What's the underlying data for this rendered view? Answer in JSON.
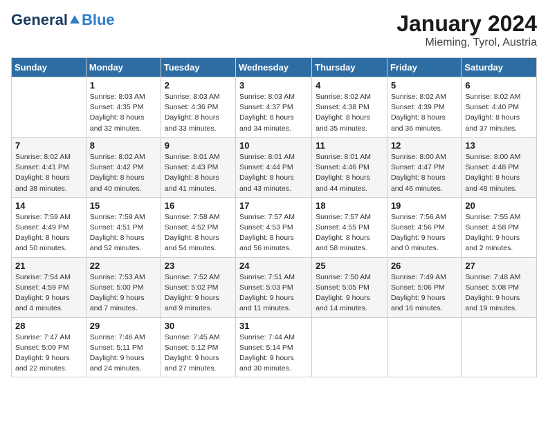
{
  "logo": {
    "general": "General",
    "blue": "Blue"
  },
  "title": "January 2024",
  "subtitle": "Mieming, Tyrol, Austria",
  "days_of_week": [
    "Sunday",
    "Monday",
    "Tuesday",
    "Wednesday",
    "Thursday",
    "Friday",
    "Saturday"
  ],
  "weeks": [
    [
      {
        "day": "",
        "detail": ""
      },
      {
        "day": "1",
        "detail": "Sunrise: 8:03 AM\nSunset: 4:35 PM\nDaylight: 8 hours\nand 32 minutes."
      },
      {
        "day": "2",
        "detail": "Sunrise: 8:03 AM\nSunset: 4:36 PM\nDaylight: 8 hours\nand 33 minutes."
      },
      {
        "day": "3",
        "detail": "Sunrise: 8:03 AM\nSunset: 4:37 PM\nDaylight: 8 hours\nand 34 minutes."
      },
      {
        "day": "4",
        "detail": "Sunrise: 8:02 AM\nSunset: 4:38 PM\nDaylight: 8 hours\nand 35 minutes."
      },
      {
        "day": "5",
        "detail": "Sunrise: 8:02 AM\nSunset: 4:39 PM\nDaylight: 8 hours\nand 36 minutes."
      },
      {
        "day": "6",
        "detail": "Sunrise: 8:02 AM\nSunset: 4:40 PM\nDaylight: 8 hours\nand 37 minutes."
      }
    ],
    [
      {
        "day": "7",
        "detail": "Sunrise: 8:02 AM\nSunset: 4:41 PM\nDaylight: 8 hours\nand 38 minutes."
      },
      {
        "day": "8",
        "detail": "Sunrise: 8:02 AM\nSunset: 4:42 PM\nDaylight: 8 hours\nand 40 minutes."
      },
      {
        "day": "9",
        "detail": "Sunrise: 8:01 AM\nSunset: 4:43 PM\nDaylight: 8 hours\nand 41 minutes."
      },
      {
        "day": "10",
        "detail": "Sunrise: 8:01 AM\nSunset: 4:44 PM\nDaylight: 8 hours\nand 43 minutes."
      },
      {
        "day": "11",
        "detail": "Sunrise: 8:01 AM\nSunset: 4:46 PM\nDaylight: 8 hours\nand 44 minutes."
      },
      {
        "day": "12",
        "detail": "Sunrise: 8:00 AM\nSunset: 4:47 PM\nDaylight: 8 hours\nand 46 minutes."
      },
      {
        "day": "13",
        "detail": "Sunrise: 8:00 AM\nSunset: 4:48 PM\nDaylight: 8 hours\nand 48 minutes."
      }
    ],
    [
      {
        "day": "14",
        "detail": "Sunrise: 7:59 AM\nSunset: 4:49 PM\nDaylight: 8 hours\nand 50 minutes."
      },
      {
        "day": "15",
        "detail": "Sunrise: 7:59 AM\nSunset: 4:51 PM\nDaylight: 8 hours\nand 52 minutes."
      },
      {
        "day": "16",
        "detail": "Sunrise: 7:58 AM\nSunset: 4:52 PM\nDaylight: 8 hours\nand 54 minutes."
      },
      {
        "day": "17",
        "detail": "Sunrise: 7:57 AM\nSunset: 4:53 PM\nDaylight: 8 hours\nand 56 minutes."
      },
      {
        "day": "18",
        "detail": "Sunrise: 7:57 AM\nSunset: 4:55 PM\nDaylight: 8 hours\nand 58 minutes."
      },
      {
        "day": "19",
        "detail": "Sunrise: 7:56 AM\nSunset: 4:56 PM\nDaylight: 9 hours\nand 0 minutes."
      },
      {
        "day": "20",
        "detail": "Sunrise: 7:55 AM\nSunset: 4:58 PM\nDaylight: 9 hours\nand 2 minutes."
      }
    ],
    [
      {
        "day": "21",
        "detail": "Sunrise: 7:54 AM\nSunset: 4:59 PM\nDaylight: 9 hours\nand 4 minutes."
      },
      {
        "day": "22",
        "detail": "Sunrise: 7:53 AM\nSunset: 5:00 PM\nDaylight: 9 hours\nand 7 minutes."
      },
      {
        "day": "23",
        "detail": "Sunrise: 7:52 AM\nSunset: 5:02 PM\nDaylight: 9 hours\nand 9 minutes."
      },
      {
        "day": "24",
        "detail": "Sunrise: 7:51 AM\nSunset: 5:03 PM\nDaylight: 9 hours\nand 11 minutes."
      },
      {
        "day": "25",
        "detail": "Sunrise: 7:50 AM\nSunset: 5:05 PM\nDaylight: 9 hours\nand 14 minutes."
      },
      {
        "day": "26",
        "detail": "Sunrise: 7:49 AM\nSunset: 5:06 PM\nDaylight: 9 hours\nand 16 minutes."
      },
      {
        "day": "27",
        "detail": "Sunrise: 7:48 AM\nSunset: 5:08 PM\nDaylight: 9 hours\nand 19 minutes."
      }
    ],
    [
      {
        "day": "28",
        "detail": "Sunrise: 7:47 AM\nSunset: 5:09 PM\nDaylight: 9 hours\nand 22 minutes."
      },
      {
        "day": "29",
        "detail": "Sunrise: 7:46 AM\nSunset: 5:11 PM\nDaylight: 9 hours\nand 24 minutes."
      },
      {
        "day": "30",
        "detail": "Sunrise: 7:45 AM\nSunset: 5:12 PM\nDaylight: 9 hours\nand 27 minutes."
      },
      {
        "day": "31",
        "detail": "Sunrise: 7:44 AM\nSunset: 5:14 PM\nDaylight: 9 hours\nand 30 minutes."
      },
      {
        "day": "",
        "detail": ""
      },
      {
        "day": "",
        "detail": ""
      },
      {
        "day": "",
        "detail": ""
      }
    ]
  ]
}
